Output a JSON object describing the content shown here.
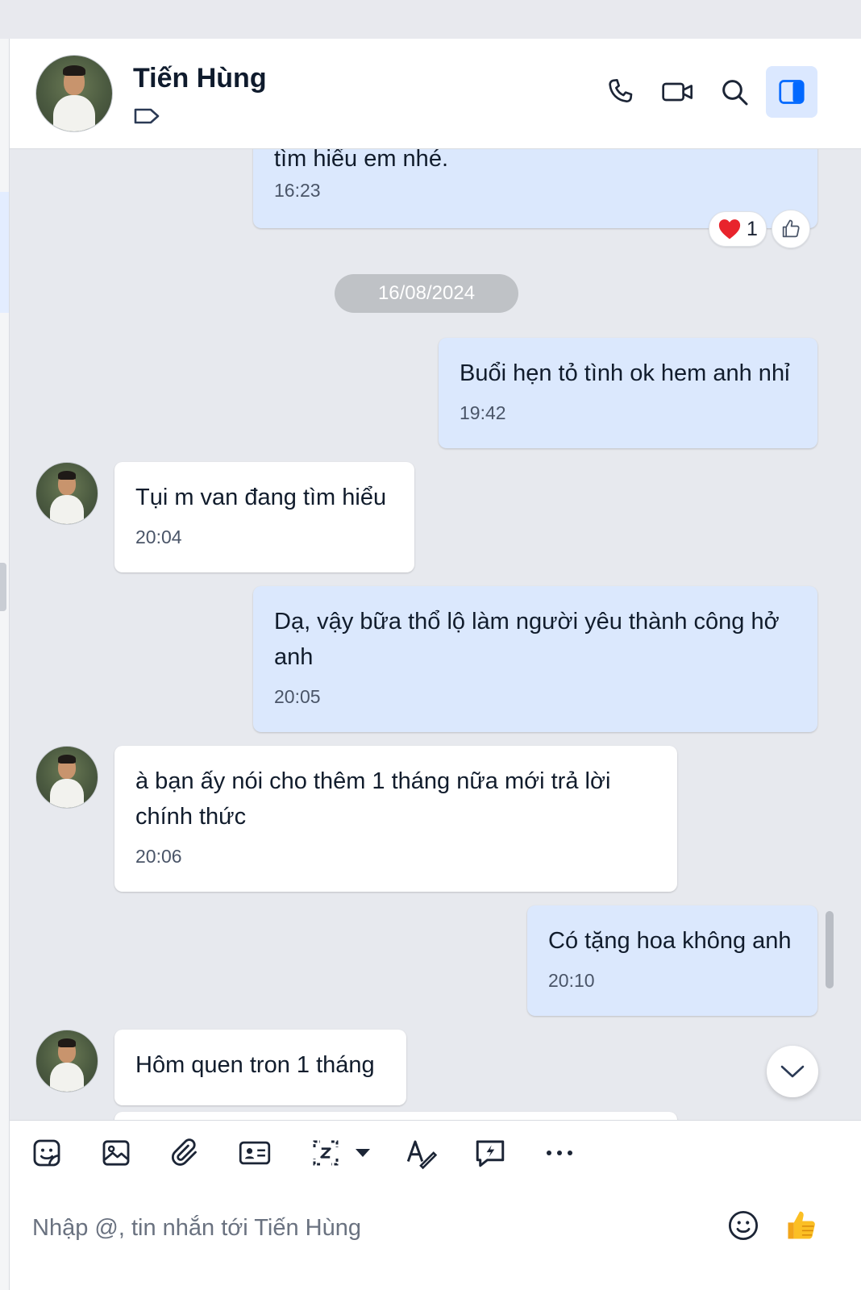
{
  "header": {
    "contact_name": "Tiến Hùng",
    "icons": [
      "tag-icon",
      "phone-icon",
      "video-call-icon",
      "search-icon",
      "sidebar-toggle-icon"
    ]
  },
  "messages": [
    {
      "dir": "out",
      "text": "tìm hiểu em nhé.",
      "time": "16:23",
      "reactions": {
        "heart_count": "1"
      }
    },
    {
      "dir": "date",
      "text": "16/08/2024"
    },
    {
      "dir": "out",
      "text": "Buổi hẹn tỏ tình ok hem anh nhỉ",
      "time": "19:42"
    },
    {
      "dir": "in",
      "text": "Tụi m van đang tìm hiểu",
      "time": "20:04"
    },
    {
      "dir": "out",
      "text": "Dạ, vậy bữa thổ lộ làm người yêu thành công hở anh",
      "time": "20:05"
    },
    {
      "dir": "in",
      "text": "à bạn ấy nói cho thêm 1 tháng nữa mới trả lời chính thức",
      "time": "20:06"
    },
    {
      "dir": "out",
      "text": "Có tặng hoa không anh",
      "time": "20:10"
    },
    {
      "dir": "in",
      "text": "Hôm quen tron 1 tháng",
      "time": ""
    }
  ],
  "toolbar": {
    "icons": [
      "sticker-icon",
      "image-icon",
      "attachment-icon",
      "contact-card-icon",
      "screenshot-icon",
      "dropdown-caret-icon",
      "text-format-icon",
      "quick-message-icon",
      "more-icon"
    ]
  },
  "composer": {
    "placeholder": "Nhập @, tin nhắn tới Tiến Hùng",
    "icons": [
      "emoji-icon",
      "thumbs-up-icon"
    ]
  },
  "colors": {
    "outgoing_bubble": "#dbe8fd",
    "incoming_bubble": "#ffffff",
    "chat_background": "#e7e9ee",
    "accent": "#0068ff"
  }
}
